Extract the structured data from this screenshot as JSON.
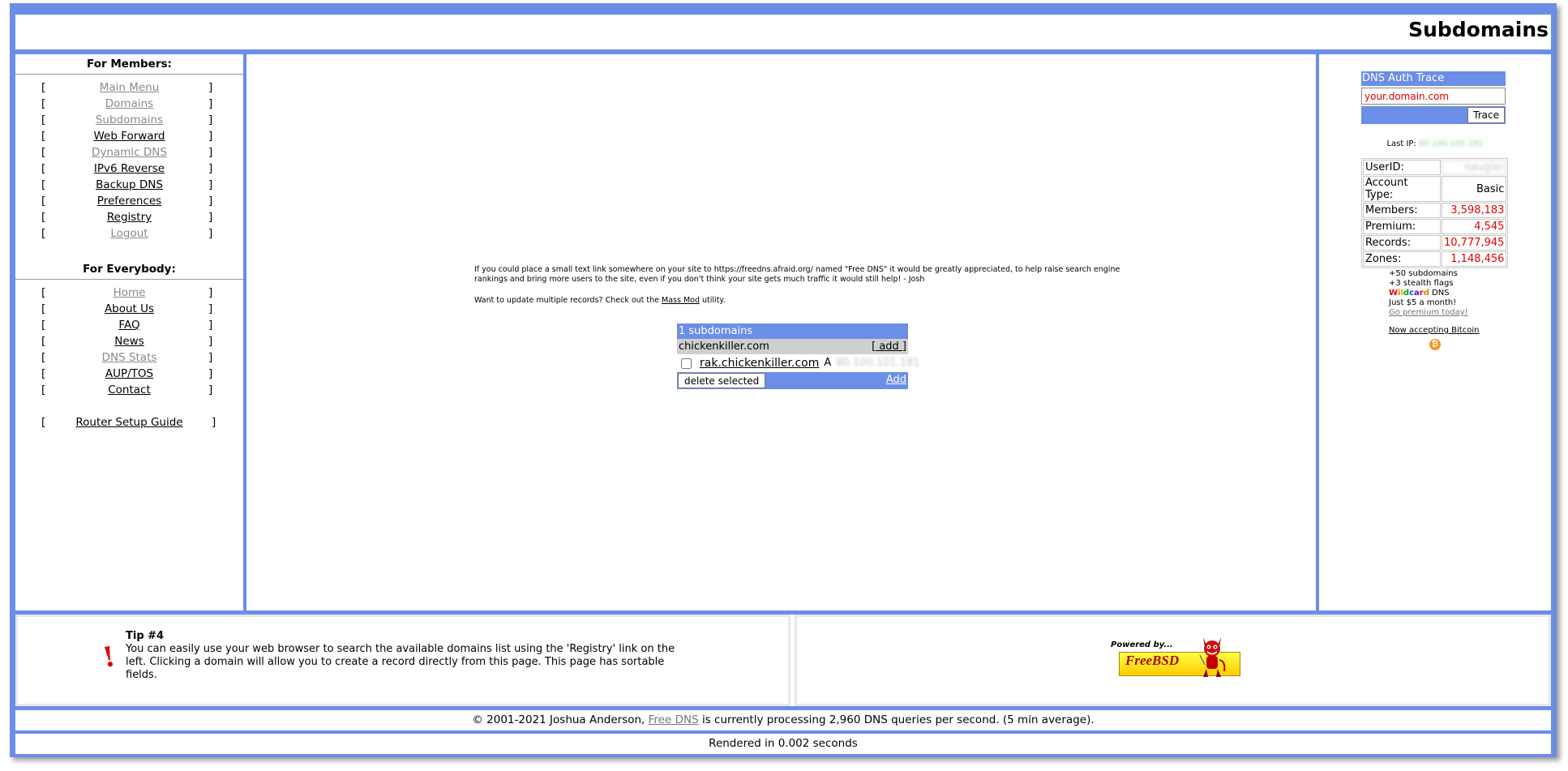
{
  "page": {
    "title": "Subdomains"
  },
  "sidebar": {
    "members_title": "For Members:",
    "members": [
      {
        "label": "Main Menu"
      },
      {
        "label": "Domains"
      },
      {
        "label": "Subdomains"
      },
      {
        "label": "Web Forward"
      },
      {
        "label": "Dynamic DNS"
      },
      {
        "label": "IPv6 Reverse"
      },
      {
        "label": "Backup DNS"
      },
      {
        "label": "Preferences"
      },
      {
        "label": "Registry"
      },
      {
        "label": "Logout"
      }
    ],
    "everybody_title": "For Everybody:",
    "everybody": [
      {
        "label": "Home"
      },
      {
        "label": "About Us"
      },
      {
        "label": "FAQ"
      },
      {
        "label": "News"
      },
      {
        "label": "DNS Stats"
      },
      {
        "label": "AUP/TOS"
      },
      {
        "label": "Contact"
      }
    ],
    "router_guide": "Router Setup Guide",
    "open_bracket": "[",
    "close_bracket": "]"
  },
  "main": {
    "notice_text": "If you could place a small text link somewhere on your site to https://freedns.afraid.org/ named \"Free DNS\" it would be greatly appreciated, to help raise search engine rankings and bring more users to the site, even if you don't think your site gets much traffic it would still help! - Josh",
    "massmod_prefix": "Want to update multiple records? Check out the ",
    "massmod_link": "Mass Mod",
    "massmod_suffix": " utility.",
    "table": {
      "header": "1 subdomains",
      "zone": "chickenkiller.com",
      "zone_add": "[ add ]",
      "record_host": "rak.chickenkiller.com",
      "record_type": "A",
      "record_value": "80.100.101.181",
      "delete_button": "delete selected",
      "add_link": "Add"
    }
  },
  "rightbar": {
    "trace_title": "DNS Auth Trace",
    "trace_placeholder": "your.domain.com",
    "trace_button": "Trace",
    "last_ip_label": "Last IP:",
    "last_ip_value": "80.100.101.181",
    "stats": [
      {
        "key": "UserID:",
        "value": "naugler"
      },
      {
        "key": "Account Type:",
        "value": "Basic"
      },
      {
        "key": "Members:",
        "value": "3,598,183"
      },
      {
        "key": "Premium:",
        "value": "4,545"
      },
      {
        "key": "Records:",
        "value": "10,777,945"
      },
      {
        "key": "Zones:",
        "value": "1,148,456"
      }
    ],
    "promo_line1": "+50 subdomains",
    "promo_line2": "+3 stealth flags",
    "promo_wildcard": "Wildcard",
    "promo_dns": " DNS",
    "promo_line4": "Just $5 a month!",
    "promo_link": "Go premium today!",
    "bitcoin_text": "Now accepting Bitcoin",
    "bitcoin_symbol": "₿"
  },
  "tip": {
    "title": "Tip #4",
    "body": "You can easily use your web browser to search the available domains list using the 'Registry' link on the left. Clicking a domain will allow you to create a record directly from this page. This page has sortable fields.",
    "icon": "!"
  },
  "badge": {
    "powered": "Powered by...",
    "name": "FreeBSD"
  },
  "footer": {
    "prefix": "© 2001-2021 Joshua Anderson, ",
    "link": "Free DNS",
    "suffix": " is currently processing 2,960 DNS queries per second. (5 min average).",
    "render": "Rendered in 0.002 seconds"
  },
  "colors": {
    "frame": "#6b8ee6",
    "accent_red": "#e00000",
    "grey_link": "#8a8a8a"
  }
}
